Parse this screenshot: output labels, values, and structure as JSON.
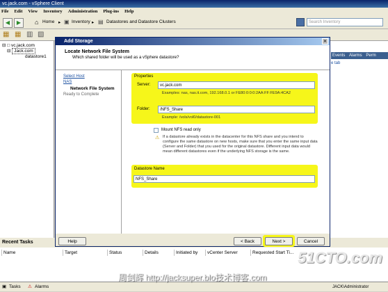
{
  "window": {
    "title": "vc.jack.com - vSphere Client"
  },
  "menu": [
    "File",
    "Edit",
    "View",
    "Inventory",
    "Administration",
    "Plug-ins",
    "Help"
  ],
  "nav": {
    "home": "Home",
    "sep1": "▸",
    "inventory": "Inventory",
    "sep2": "▸",
    "location": "Datastores and Datastore Clusters"
  },
  "search": {
    "placeholder": "Search Inventory"
  },
  "tree": {
    "root": "vc.jack.com",
    "datacenter": "Jack.com",
    "datastore": "datastore1"
  },
  "right_tabs": {
    "events": "Events",
    "alarms": "Alarms",
    "perm": "Perm",
    "link": "e tab"
  },
  "dialog": {
    "title": "Add Storage",
    "header_title": "Locate Network File System",
    "header_subtitle": "Which shared folder will be used as a vSphere datastore?",
    "steps": [
      {
        "label": "Select Host"
      },
      {
        "label": "NAS"
      },
      {
        "label": "Network File System"
      },
      {
        "label": "Ready to Complete"
      }
    ],
    "properties_label": "Properties",
    "server_label": "Server:",
    "server_value": "vc.jack.com",
    "server_examples": "Examples: nas, nas.it.com, 192.168.0.1 or FE80:0:0:0:2AA:FF:FE9A:4CA2",
    "folder_label": "Folder:",
    "folder_value": "/NFS_Share",
    "folder_example": "Example: /vols/vol0/datastore-001",
    "mount_readonly_label": "Mount NFS read only",
    "warning_text": "If a datastore already exists in the datacenter for this NFS share and you intend to configure the same datastore on new hosts, make sure that you enter the same input data (Server and Folder) that you used for the original datastore. Different input data would mean different datastores even if the underlying NFS storage is the same.",
    "datastore_name_label": "Datastore Name",
    "datastore_name_value": "NFS_Share",
    "help_button": "Help",
    "back_button": "< Back",
    "next_button": "Next >",
    "cancel_button": "Cancel"
  },
  "recent_tasks": {
    "title": "Recent Tasks",
    "columns": [
      "Name",
      "Target",
      "Status",
      "Details",
      "Initiated by",
      "vCenter Server",
      "Requested Start Ti..."
    ]
  },
  "statusbar": {
    "tasks": "Tasks",
    "alarms": "Alarms",
    "user": "JACK\\Administrator"
  },
  "watermark": {
    "brand": "51CTO.com",
    "credit": "周剑辉 http://jacksuper.blo技术博客.com"
  }
}
